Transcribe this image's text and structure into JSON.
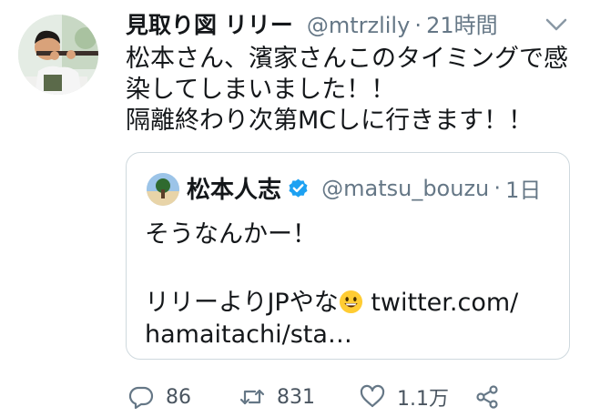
{
  "tweet": {
    "author_name": "見取り図 リリー",
    "handle": "@mtrzlily",
    "separator": "·",
    "time": "21時間",
    "lines": [
      "松本さん、濱家さんこのタイミングで感",
      "染してしまいました！！",
      "隔離終わり次第MCしに行きます！！"
    ]
  },
  "quoted": {
    "author_name": "松本人志",
    "handle": "@matsu_bouzu",
    "separator": "·",
    "time": "1日",
    "line1": "そうなんかー！",
    "line2_text": "リリーよりJPやな",
    "line2_link": "twitter.com/",
    "line3": "hamaitachi/sta…"
  },
  "actions": {
    "reply_count": "86",
    "retweet_count": "831",
    "like_count": "1.1万"
  },
  "icons": {
    "reply": "reply-icon",
    "retweet": "retweet-icon",
    "like": "heart-icon",
    "share": "share-icon",
    "menu": "chevron-down-icon",
    "verified": "verified-badge-icon",
    "emoji": "grinning-face-emoji"
  },
  "colors": {
    "text": "#14171a",
    "secondary": "#657786",
    "verified": "#1da1f2",
    "border": "#cfd9de"
  }
}
